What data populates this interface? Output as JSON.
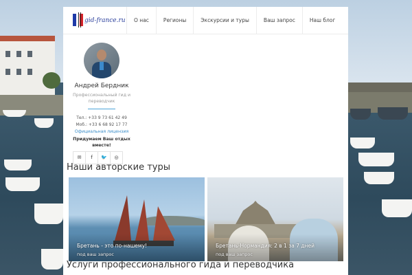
{
  "brand": {
    "logo_text": "gid-france.ru",
    "flag_colors": [
      "#1e3aa8",
      "#ffffff",
      "#d8232a"
    ]
  },
  "nav": {
    "items": [
      {
        "label": "О нас"
      },
      {
        "label": "Регионы"
      },
      {
        "label": "Экскурсии и туры"
      },
      {
        "label": "Ваш запрос"
      },
      {
        "label": "Наш блог"
      }
    ]
  },
  "profile": {
    "name": "Андрей Бердник",
    "role": "Профессиональный гид и переводчик",
    "tel": "Тел.: +33 9 73 61 42 49",
    "mob": "Моб.: +33 6 68 92 17 77",
    "license": "Официальная лицензия",
    "invite": "Придумаем Ваш отдых вместе!"
  },
  "social": [
    {
      "icon": "mail-icon",
      "glyph": "✉"
    },
    {
      "icon": "facebook-icon",
      "glyph": "f"
    },
    {
      "icon": "twitter-icon",
      "glyph": "🐦"
    },
    {
      "icon": "instagram-icon",
      "glyph": "◎"
    }
  ],
  "tours_heading": "Наши авторские туры",
  "tours": [
    {
      "title": "Бретань - это по-нашему!",
      "subtitle": "под ваш запрос"
    },
    {
      "title": "Бретань-Нормандия: 2 в 1 за 7 дней",
      "subtitle": "под ваш запрос"
    }
  ],
  "services_heading": "Услуги профессионального гида и переводчика",
  "colors": {
    "accent": "#3b8ec9",
    "panel": "#ffffff",
    "text": "#333333"
  }
}
